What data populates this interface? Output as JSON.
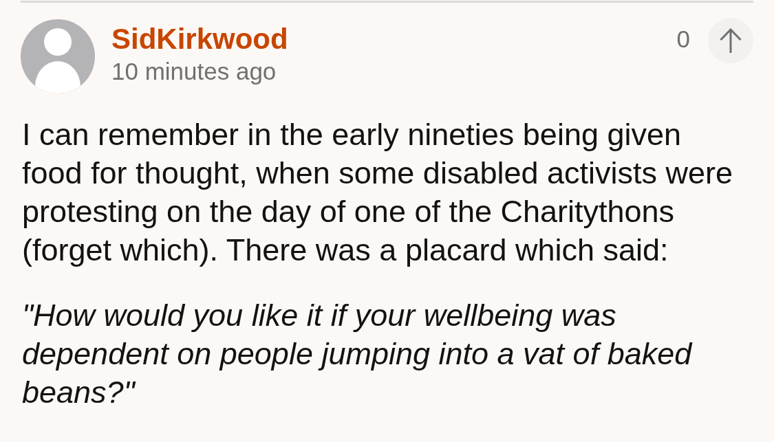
{
  "comment": {
    "author": "SidKirkwood",
    "time": "10 minutes ago",
    "recommend_count": "0",
    "paragraphs": [
      {
        "kind": "plain",
        "text": "I can remember in the early nineties being given food for thought, when some disabled activists were protesting on the day of one of the Charitythons (forget which). There was a placard which said:"
      },
      {
        "kind": "quote",
        "text": "\"How would you like it if your wellbeing was dependent on people jumping into a vat of baked beans?\""
      }
    ]
  }
}
